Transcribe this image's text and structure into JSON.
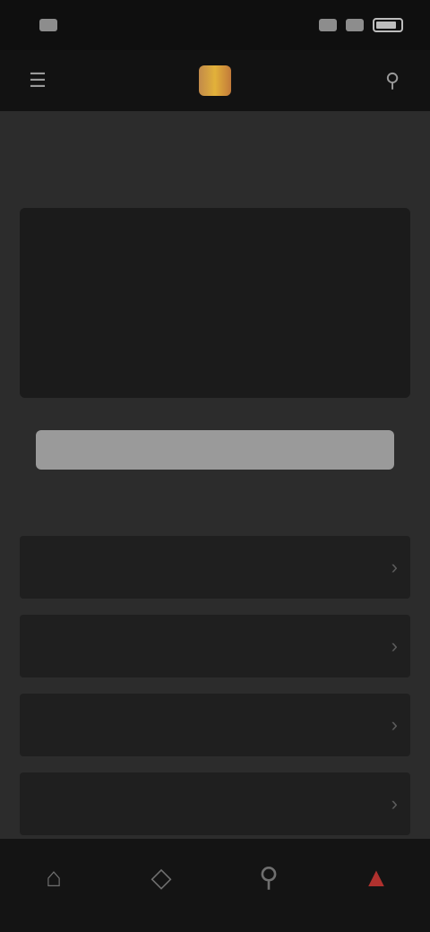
{
  "status_bar": {
    "time": "",
    "battery_icon": "battery-icon",
    "signal_icon": "signal-icon",
    "wifi_icon": "wifi-icon"
  },
  "top_bar": {
    "menu_icon": "menu-icon",
    "logo_text": "",
    "search_icon": "search-icon"
  },
  "page": {
    "title": "",
    "card_text": "",
    "primary_button": ""
  },
  "list": {
    "items": [
      {
        "label": ""
      },
      {
        "label": ""
      },
      {
        "label": ""
      },
      {
        "label": ""
      },
      {
        "label": ""
      }
    ]
  },
  "bottom_nav": {
    "items": [
      {
        "icon": "home-icon",
        "label": ""
      },
      {
        "icon": "tag-icon",
        "label": ""
      },
      {
        "icon": "pin-icon",
        "label": ""
      },
      {
        "icon": "user-icon",
        "label": ""
      }
    ]
  },
  "colors": {
    "background": "#2c2c2c",
    "card": "#1b1b1b",
    "accent": "#b0312e",
    "logo_gold": "#e2b13a"
  }
}
